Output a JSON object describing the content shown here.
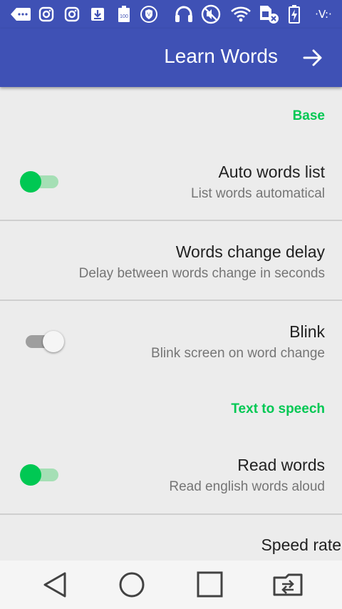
{
  "status_bar": {
    "icons": [
      "keyboard-back-icon",
      "instagram-icon",
      "instagram-icon",
      "download-icon",
      "battery-100-icon",
      "shield-icon",
      "headphones-icon",
      "mute-icon",
      "wifi-icon",
      "sim-no-signal-icon",
      "battery-charging-icon"
    ],
    "right_text": "·V:·"
  },
  "app_bar": {
    "title": "Learn Words",
    "action_icon": "arrow-right-icon"
  },
  "settings": {
    "categories": [
      {
        "label": "Base"
      },
      {
        "label": "Text to speech"
      }
    ],
    "preferences": [
      {
        "title": "Auto words list",
        "summary": "List words automatical",
        "switch": true
      },
      {
        "title": "Words change delay",
        "summary": "Delay between words change in seconds"
      },
      {
        "title": "Blink",
        "summary": "Blink screen on word change",
        "switch": false
      },
      {
        "title": "Read words",
        "summary": "Read english words aloud",
        "switch": true
      },
      {
        "title": "Speed rate"
      }
    ]
  },
  "nav_bar": {
    "buttons": [
      "back-icon",
      "home-icon",
      "recents-icon",
      "screen-rotate-icon"
    ]
  },
  "colors": {
    "primary": "#3f51b5",
    "accent": "#00c853",
    "background": "#ececec",
    "title_text": "#212121",
    "summary_text": "#757575"
  }
}
